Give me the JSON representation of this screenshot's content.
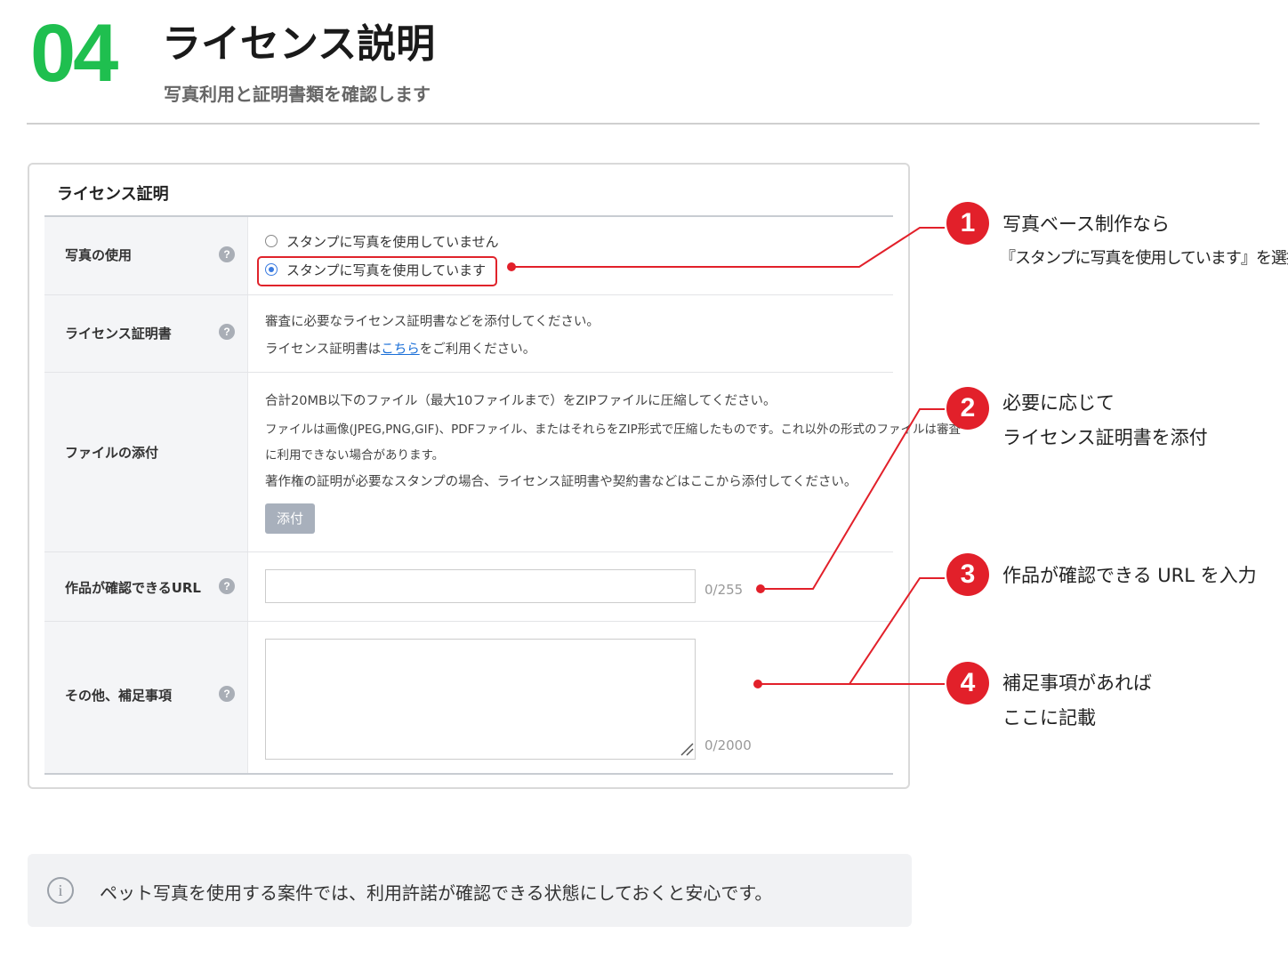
{
  "header": {
    "step_number": "04",
    "title": "ライセンス説明",
    "subtitle": "写真利用と証明書類を確認します"
  },
  "form": {
    "panel_title": "ライセンス証明",
    "help_glyph": "?",
    "rows": {
      "photo_usage": {
        "label": "写真の使用",
        "options": [
          {
            "label": "スタンプに写真を使用していません",
            "selected": false
          },
          {
            "label": "スタンプに写真を使用しています",
            "selected": true
          }
        ]
      },
      "license_certificate": {
        "label": "ライセンス証明書",
        "line1": "審査に必要なライセンス証明書などを添付してください。",
        "line2_prefix": "ライセンス証明書は",
        "line2_link": "こちら",
        "line2_suffix": "をご利用ください。"
      },
      "file_attachment": {
        "label": "ファイルの添付",
        "lines": [
          "合計20MB以下のファイル（最大10ファイルまで）をZIPファイルに圧縮してください。",
          "ファイルは画像(JPEG,PNG,GIF)、PDFファイル、またはそれらをZIP形式で圧縮したものです。これ以外の形式のファイルは審査",
          "に利用できない場合があります。",
          "著作権の証明が必要なスタンプの場合、ライセンス証明書や契約書などはここから添付してください。"
        ],
        "button_label": "添付"
      },
      "work_url": {
        "label": "作品が確認できるURL",
        "value": "",
        "counter": "0/255"
      },
      "notes": {
        "label": "その他、補足事項",
        "value": "",
        "counter": "0/2000"
      }
    }
  },
  "callouts": [
    {
      "number": "1",
      "line1": "写真ベース制作なら",
      "line2": "『スタンプに写真を使用しています』を選択"
    },
    {
      "number": "2",
      "line1": "必要に応じて",
      "line2": "ライセンス証明書を添付"
    },
    {
      "number": "3",
      "line1": "作品が確認できる URL を入力"
    },
    {
      "number": "4",
      "line1": "補足事項があれば",
      "line2": "ここに記載"
    }
  ],
  "info": {
    "icon": "i",
    "text": "ペット写真を使用する案件では、利用許諾が確認できる状態にしておくと安心です。"
  },
  "colors": {
    "accent_green": "#1fbf4f",
    "callout_red": "#e2202a",
    "link_blue": "#1a6fd8"
  }
}
